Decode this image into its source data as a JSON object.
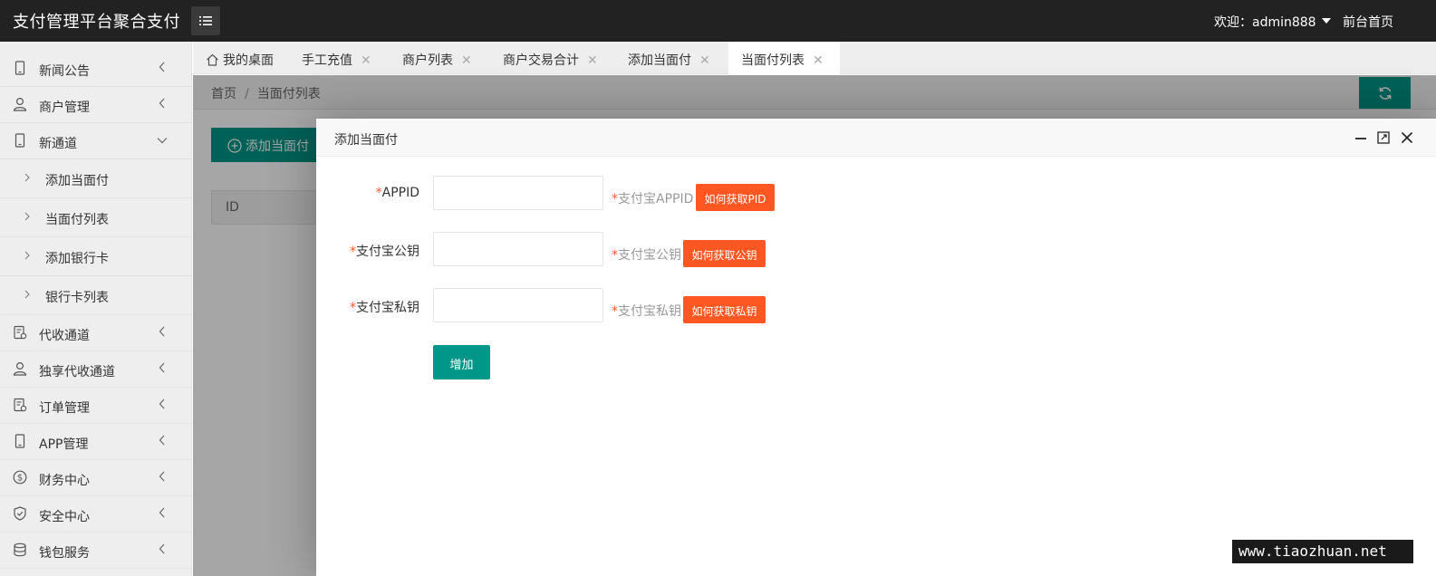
{
  "header": {
    "logo": "支付管理平台聚合支付",
    "user_label": "欢迎：admin888",
    "home_link": "前台首页",
    "colors": {
      "bg": "#222222",
      "accent": "#009688",
      "warn": "#ff5722"
    }
  },
  "sidebar": {
    "items": [
      {
        "label": "新闻公告",
        "icon": "phone-icon"
      },
      {
        "label": "商户管理",
        "icon": "user-icon"
      },
      {
        "label": "新通道",
        "icon": "phone-icon",
        "expanded": true
      },
      {
        "label": "代收通道",
        "icon": "doc-icon"
      },
      {
        "label": "独享代收通道",
        "icon": "user-icon"
      },
      {
        "label": "订单管理",
        "icon": "doc-icon"
      },
      {
        "label": "APP管理",
        "icon": "phone-icon"
      },
      {
        "label": "财务中心",
        "icon": "dollar-icon"
      },
      {
        "label": "安全中心",
        "icon": "shield-icon"
      },
      {
        "label": "钱包服务",
        "icon": "database-icon"
      }
    ],
    "sub_items": [
      {
        "label": "添加当面付"
      },
      {
        "label": "当面付列表"
      },
      {
        "label": "添加银行卡"
      },
      {
        "label": "银行卡列表"
      }
    ]
  },
  "tabs": [
    {
      "label": "我的桌面",
      "closable": false
    },
    {
      "label": "手工充值",
      "closable": true
    },
    {
      "label": "商户列表",
      "closable": true
    },
    {
      "label": "商户交易合计",
      "closable": true
    },
    {
      "label": "添加当面付",
      "closable": true
    },
    {
      "label": "当面付列表",
      "closable": true,
      "active": true
    }
  ],
  "tab_close_glyph": "✕",
  "content": {
    "breadcrumb": {
      "home": "首页",
      "separator": "/",
      "current": "当面付列表"
    },
    "add_button": "添加当面付",
    "table_header_id": "ID"
  },
  "modal": {
    "title": "添加当面付",
    "required_mark": "*",
    "fields": [
      {
        "label": "APPID",
        "value": "",
        "hint": "支付宝APPID",
        "tip": "如何获取PID"
      },
      {
        "label": "支付宝公钥",
        "value": "",
        "hint": "支付宝公钥",
        "tip": "如何获取公钥"
      },
      {
        "label": "支付宝私钥",
        "value": "",
        "hint": "支付宝私钥",
        "tip": "如何获取私钥"
      }
    ],
    "submit": "增加"
  },
  "watermark": "www.tiaozhuan.net"
}
